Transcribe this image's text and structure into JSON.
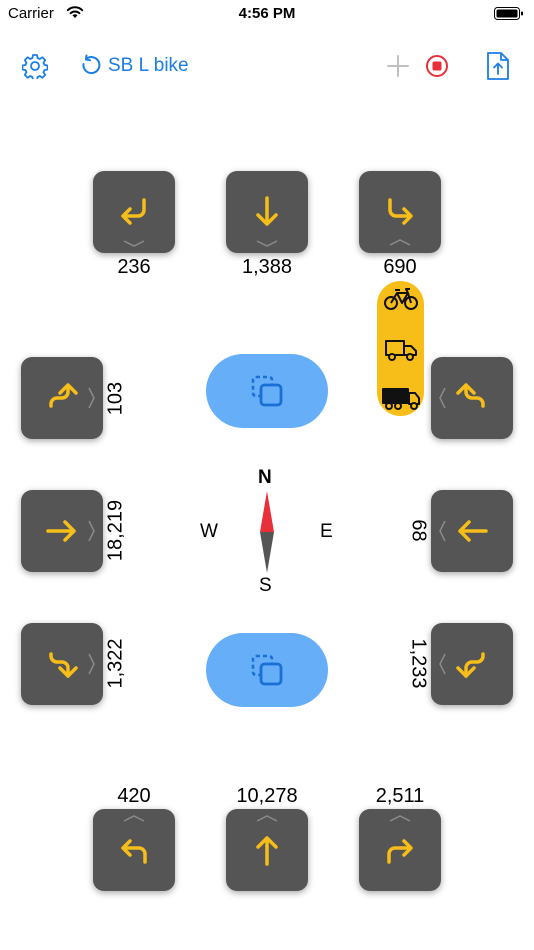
{
  "status_bar": {
    "carrier": "Carrier",
    "time": "4:56 PM"
  },
  "toolbar": {
    "title": "SB L bike",
    "icons": [
      "gear-icon",
      "undo-icon",
      "plus-icon",
      "record-stop-icon",
      "export-icon"
    ]
  },
  "colors": {
    "accent_blue": "#1a7ee6",
    "tile_gray": "#555555",
    "arrow_yellow": "#f7be19",
    "copy_button": "#66aef7",
    "record_red": "#e8303a",
    "compass_red": "#e8303a"
  },
  "approaches": {
    "south_top": {
      "left": "236",
      "through": "1,388",
      "right": "690"
    },
    "north_bottom": {
      "left": "420",
      "through": "10,278",
      "right": "2,511"
    },
    "west_side": {
      "top": "103",
      "middle": "18,219",
      "bottom": "1,322"
    },
    "east_side": {
      "top": "",
      "middle": "68",
      "bottom": "1,233"
    }
  },
  "compass": {
    "north": "N",
    "south": "S",
    "east": "E",
    "west": "W"
  },
  "vehicle_selector": [
    "bicycle-icon",
    "truck-icon",
    "semi-truck-icon"
  ]
}
